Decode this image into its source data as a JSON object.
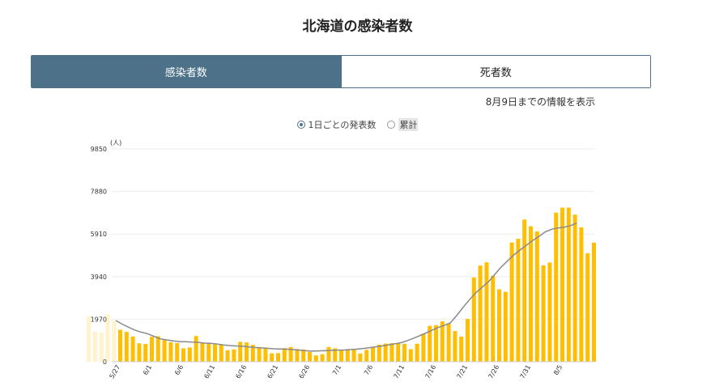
{
  "page": {
    "title": "北海道の感染者数",
    "tabs": [
      {
        "label": "感染者数",
        "active": true
      },
      {
        "label": "死者数",
        "active": false
      }
    ],
    "as_of": "8月9日までの情報を表示",
    "radio_options": [
      {
        "label": "1日ごとの発表数",
        "selected": true
      },
      {
        "label": "累計",
        "selected": false
      }
    ]
  },
  "colors": {
    "tab_active": "#4c7189",
    "bar": "#ffbe00",
    "avg_line": "#8a8a8a"
  },
  "chart_data": {
    "type": "bar",
    "unit_label": "(人)",
    "ylim": [
      0,
      9850
    ],
    "yticks": [
      "0",
      "1970",
      "3940",
      "5910",
      "7880",
      "9850"
    ],
    "x_tick_labels": [
      "5/27",
      "6/1",
      "6/6",
      "6/11",
      "6/16",
      "6/21",
      "6/26",
      "7/1",
      "7/6",
      "7/11",
      "7/16",
      "7/21",
      "7/26",
      "7/31",
      "8/5"
    ],
    "leading_faded_values": [
      2100,
      1400,
      1350,
      2200,
      1900
    ],
    "values": [
      1480,
      1380,
      1170,
      850,
      820,
      1150,
      1180,
      1000,
      900,
      860,
      620,
      660,
      1190,
      880,
      850,
      800,
      790,
      530,
      570,
      920,
      890,
      780,
      680,
      610,
      390,
      400,
      630,
      680,
      590,
      570,
      450,
      290,
      350,
      680,
      620,
      540,
      540,
      560,
      380,
      550,
      680,
      790,
      840,
      860,
      870,
      830,
      580,
      830,
      1290,
      1660,
      1690,
      1870,
      1770,
      1420,
      1160,
      1980,
      3900,
      4450,
      4600,
      3980,
      3350,
      3230,
      5520,
      5690,
      6580,
      6270,
      6030,
      4460,
      4590,
      6900,
      7130,
      7130,
      6810,
      6220,
      5020,
      5510
    ],
    "moving_average": [
      1910,
      1740,
      1600,
      1470,
      1370,
      1300,
      1180,
      1060,
      1010,
      970,
      930,
      930,
      910,
      900,
      860,
      850,
      820,
      780,
      750,
      730,
      720,
      690,
      660,
      640,
      620,
      600,
      590,
      580,
      560,
      540,
      510,
      490,
      500,
      510,
      520,
      540,
      540,
      560,
      580,
      610,
      640,
      680,
      720,
      770,
      820,
      870,
      960,
      1070,
      1190,
      1320,
      1450,
      1580,
      1680,
      1800,
      2150,
      2520,
      2870,
      3190,
      3450,
      3700,
      4040,
      4380,
      4660,
      4940,
      5170,
      5390,
      5610,
      5800,
      6010,
      6130,
      6190,
      6230,
      6300,
      6420
    ]
  }
}
